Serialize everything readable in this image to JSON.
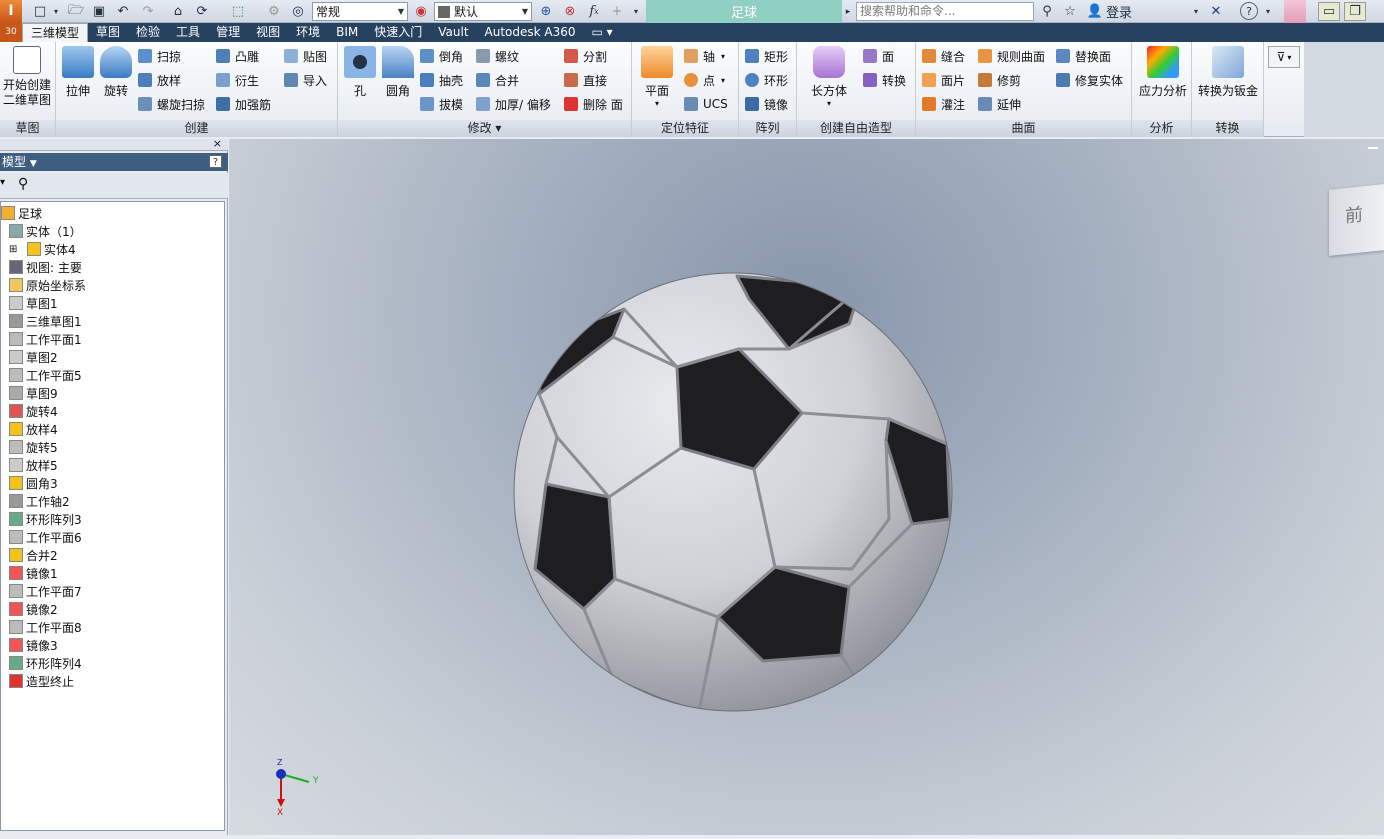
{
  "app_logo_text": "I",
  "qat": {
    "style_value": "常规",
    "appearance_value": "默认",
    "fx_label": "f",
    "fx_sub": "x"
  },
  "document_title": "足球",
  "search": {
    "placeholder": "搜索帮助和命令..."
  },
  "login_label": "登录",
  "tabs": [
    "三维模型",
    "草图",
    "检验",
    "工具",
    "管理",
    "视图",
    "环境",
    "BIM",
    "快速入门",
    "Vault",
    "Autodesk A360"
  ],
  "ribbon": {
    "sketch": {
      "title": "草图",
      "start_label_line1": "开始创建",
      "start_label_line2": "二维草图"
    },
    "create": {
      "title": "创建",
      "extrude": "拉伸",
      "revolve": "旋转",
      "sweep": "扫掠",
      "loft": "放样",
      "coil": "螺旋扫掠",
      "emboss": "凸雕",
      "derive": "衍生",
      "rib": "加强筋",
      "sticker": "贴图",
      "import": "导入"
    },
    "modify": {
      "title": "修改",
      "hole": "孔",
      "fillet": "圆角",
      "chamfer": "倒角",
      "shell": "抽壳",
      "draft": "拔模",
      "thread": "螺纹",
      "combine": "合并",
      "thicken": "加厚/ 偏移",
      "split": "分割",
      "direct": "直接",
      "delete_face": "删除 面"
    },
    "work": {
      "title": "定位特征",
      "plane": "平面",
      "axis": "轴",
      "point": "点",
      "ucs": "UCS"
    },
    "pattern": {
      "title": "阵列",
      "rect": "矩形",
      "circ": "环形",
      "mirror": "镜像"
    },
    "freeform": {
      "title": "创建自由造型",
      "box": "长方体",
      "face": "面",
      "convert": "转换"
    },
    "surface": {
      "title": "曲面",
      "stitch": "缝合",
      "patch": "面片",
      "sculpt": "灌注",
      "ruled": "规则曲面",
      "trim": "修剪",
      "extend": "延伸",
      "replace": "替换面",
      "repair": "修复实体"
    },
    "analysis": {
      "title": "分析",
      "stress": "应力分析"
    },
    "convert": {
      "title": "转换",
      "sheetmetal": "转换为钣金"
    }
  },
  "browser": {
    "title": "模型",
    "tree": [
      {
        "label": "足球",
        "level": 0
      },
      {
        "label": "实体（1）",
        "level": 1
      },
      {
        "label": "实体4",
        "level": 2
      },
      {
        "label": "视图:  主要",
        "level": 1
      },
      {
        "label": "原始坐标系",
        "level": 1
      },
      {
        "label": "草图1",
        "level": 1
      },
      {
        "label": "三维草图1",
        "level": 1
      },
      {
        "label": "工作平面1",
        "level": 1
      },
      {
        "label": "草图2",
        "level": 1
      },
      {
        "label": "工作平面5",
        "level": 1
      },
      {
        "label": "草图9",
        "level": 1
      },
      {
        "label": "旋转4",
        "level": 1
      },
      {
        "label": "放样4",
        "level": 1
      },
      {
        "label": "旋转5",
        "level": 1
      },
      {
        "label": "放样5",
        "level": 1
      },
      {
        "label": "圆角3",
        "level": 1
      },
      {
        "label": "工作轴2",
        "level": 1
      },
      {
        "label": "环形阵列3",
        "level": 1
      },
      {
        "label": "工作平面6",
        "level": 1
      },
      {
        "label": "合并2",
        "level": 1
      },
      {
        "label": "镜像1",
        "level": 1
      },
      {
        "label": "工作平面7",
        "level": 1
      },
      {
        "label": "镜像2",
        "level": 1
      },
      {
        "label": "工作平面8",
        "level": 1
      },
      {
        "label": "镜像3",
        "level": 1
      },
      {
        "label": "环形阵列4",
        "level": 1
      },
      {
        "label": "造型终止",
        "level": 1
      }
    ]
  },
  "viewcube_label": "前",
  "triad": {
    "z": "Z",
    "y": "Y",
    "x": "X"
  },
  "colors": {
    "tab_bar": "#27425f",
    "title_tab": "#8fd0c3",
    "browser_header": "#3f5d7f"
  }
}
